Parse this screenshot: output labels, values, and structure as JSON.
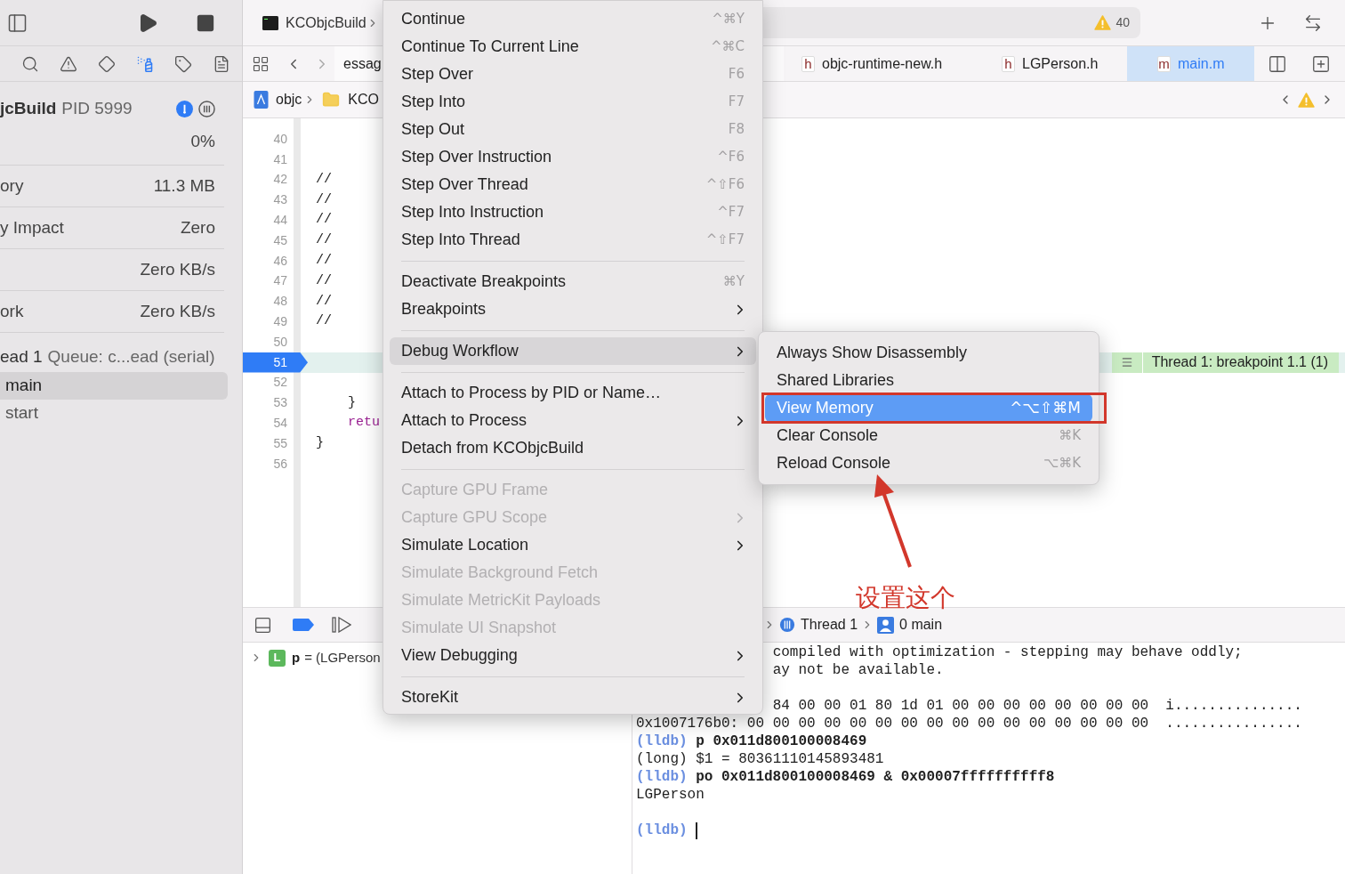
{
  "sidebar": {
    "process": {
      "name": "jcBuild",
      "pid": "PID 5999"
    },
    "gauges": [
      {
        "value": "0%"
      },
      {
        "label": "ory",
        "value": "11.3 MB"
      },
      {
        "label": "y Impact",
        "value": "Zero"
      },
      {
        "value": "Zero KB/s"
      },
      {
        "label": "ork",
        "value": "Zero KB/s"
      }
    ],
    "thread": {
      "name": "ead 1",
      "detail": "Queue: c...ead (serial)"
    },
    "frames": [
      {
        "label": "main",
        "selected": true
      },
      {
        "label": "start",
        "selected": false
      }
    ]
  },
  "toolbar": {
    "scheme": "KCObjcBuild",
    "warning_count": "40"
  },
  "tabs": [
    {
      "label": "essag",
      "selected": false
    },
    {
      "file_type": "h",
      "label": "objc-runtime-new.h",
      "selected": false
    },
    {
      "file_type": "h",
      "label": "LGPerson.h",
      "selected": false
    },
    {
      "file_type": "m",
      "label": "main.m",
      "selected": true
    }
  ],
  "jump_bar": [
    {
      "kind": "project",
      "label": "objc"
    },
    {
      "kind": "folder",
      "label": "KCO"
    }
  ],
  "code_lines": [
    {
      "number": "40",
      "kind": "plain",
      "breakpoint": false
    },
    {
      "number": "41",
      "kind": "plain",
      "breakpoint": false
    },
    {
      "number": "42",
      "code": "//",
      "kind": "plain",
      "breakpoint": false
    },
    {
      "number": "43",
      "code": "//",
      "kind": "plain",
      "breakpoint": false
    },
    {
      "number": "44",
      "code": "//",
      "kind": "plain",
      "breakpoint": false
    },
    {
      "number": "45",
      "code": "//",
      "kind": "plain",
      "breakpoint": false
    },
    {
      "number": "46",
      "code": "//",
      "kind": "plain",
      "breakpoint": false
    },
    {
      "number": "47",
      "code": "//",
      "kind": "plain",
      "breakpoint": false
    },
    {
      "number": "48",
      "code": "//",
      "kind": "plain",
      "breakpoint": false
    },
    {
      "number": "49",
      "code": "//",
      "kind": "plain",
      "breakpoint": false
    },
    {
      "number": "50",
      "kind": "plain",
      "breakpoint": false
    },
    {
      "number": "51",
      "kind": "plain",
      "breakpoint": true,
      "annotation": "Thread 1: breakpoint 1.1 (1)"
    },
    {
      "number": "52",
      "kind": "plain",
      "breakpoint": false
    },
    {
      "number": "53",
      "code": "    }",
      "kind": "plain",
      "breakpoint": false
    },
    {
      "number": "54",
      "code": "    retu",
      "kind": "keyword",
      "breakpoint": false
    },
    {
      "number": "55",
      "code": "}",
      "kind": "plain",
      "breakpoint": false
    },
    {
      "number": "56",
      "kind": "plain",
      "breakpoint": false
    }
  ],
  "debug_bar": {
    "path": [
      {
        "kind": "thread",
        "label": "Thread 1"
      },
      {
        "kind": "frame",
        "label": "0 main"
      }
    ]
  },
  "variables": [
    {
      "scope": "L",
      "name": "p",
      "value": "= (LGPerson",
      "expanded": false
    }
  ],
  "console": [
    {
      "kind": "tail",
      "text": "compiled with optimization - stepping may behave oddly;"
    },
    {
      "kind": "tail",
      "text": "ay not be available."
    },
    {
      "kind": "blank"
    },
    {
      "kind": "tail",
      "text": "84 00 00 01 80 1d 01 00 00 00 00 00 00 00 00  i..............."
    },
    {
      "kind": "output",
      "text": "0x1007176b0: 00 00 00 00 00 00 00 00 00 00 00 00 00 00 00 00  ................"
    },
    {
      "kind": "command",
      "prompt": "(lldb)",
      "text": "p 0x011d800100008469"
    },
    {
      "kind": "output",
      "text": "(long) $1 = 80361110145893481"
    },
    {
      "kind": "command",
      "prompt": "(lldb)",
      "text": "po 0x011d800100008469 & 0x00007ffffffffff8"
    },
    {
      "kind": "output",
      "text": "LGPerson"
    },
    {
      "kind": "blank"
    },
    {
      "kind": "input",
      "prompt": "(lldb)"
    }
  ],
  "menu": [
    {
      "kind": "item",
      "label": "Continue",
      "shortcut": "^⌘Y",
      "submenu": false,
      "disabled": false,
      "selected": false
    },
    {
      "kind": "item",
      "label": "Continue To Current Line",
      "shortcut": "^⌘C",
      "submenu": false,
      "disabled": false,
      "selected": false
    },
    {
      "kind": "item",
      "label": "Step Over",
      "shortcut": "F6",
      "submenu": false,
      "disabled": false,
      "selected": false
    },
    {
      "kind": "item",
      "label": "Step Into",
      "shortcut": "F7",
      "submenu": false,
      "disabled": false,
      "selected": false
    },
    {
      "kind": "item",
      "label": "Step Out",
      "shortcut": "F8",
      "submenu": false,
      "disabled": false,
      "selected": false
    },
    {
      "kind": "item",
      "label": "Step Over Instruction",
      "shortcut": "^F6",
      "submenu": false,
      "disabled": false,
      "selected": false
    },
    {
      "kind": "item",
      "label": "Step Over Thread",
      "shortcut": "^⇧F6",
      "submenu": false,
      "disabled": false,
      "selected": false
    },
    {
      "kind": "item",
      "label": "Step Into Instruction",
      "shortcut": "^F7",
      "submenu": false,
      "disabled": false,
      "selected": false
    },
    {
      "kind": "item",
      "label": "Step Into Thread",
      "shortcut": "^⇧F7",
      "submenu": false,
      "disabled": false,
      "selected": false
    },
    {
      "kind": "separator"
    },
    {
      "kind": "item",
      "label": "Deactivate Breakpoints",
      "shortcut": "⌘Y",
      "submenu": false,
      "disabled": false,
      "selected": false
    },
    {
      "kind": "item",
      "label": "Breakpoints",
      "submenu": true,
      "disabled": false,
      "selected": false
    },
    {
      "kind": "separator"
    },
    {
      "kind": "item",
      "label": "Debug Workflow",
      "submenu": true,
      "disabled": false,
      "selected": true
    },
    {
      "kind": "separator"
    },
    {
      "kind": "item",
      "label": "Attach to Process by PID or Name…",
      "submenu": false,
      "disabled": false,
      "selected": false
    },
    {
      "kind": "item",
      "label": "Attach to Process",
      "submenu": true,
      "disabled": false,
      "selected": false
    },
    {
      "kind": "item",
      "label": "Detach from KCObjcBuild",
      "submenu": false,
      "disabled": false,
      "selected": false
    },
    {
      "kind": "separator"
    },
    {
      "kind": "item",
      "label": "Capture GPU Frame",
      "submenu": false,
      "disabled": true,
      "selected": false
    },
    {
      "kind": "item",
      "label": "Capture GPU Scope",
      "submenu": true,
      "disabled": true,
      "selected": false
    },
    {
      "kind": "item",
      "label": "Simulate Location",
      "submenu": true,
      "disabled": false,
      "selected": false
    },
    {
      "kind": "item",
      "label": "Simulate Background Fetch",
      "submenu": false,
      "disabled": true,
      "selected": false
    },
    {
      "kind": "item",
      "label": "Simulate MetricKit Payloads",
      "submenu": false,
      "disabled": true,
      "selected": false
    },
    {
      "kind": "item",
      "label": "Simulate UI Snapshot",
      "submenu": false,
      "disabled": true,
      "selected": false
    },
    {
      "kind": "item",
      "label": "View Debugging",
      "submenu": true,
      "disabled": false,
      "selected": false
    },
    {
      "kind": "separator"
    },
    {
      "kind": "item",
      "label": "StoreKit",
      "submenu": true,
      "disabled": false,
      "selected": false
    }
  ],
  "submenu": [
    {
      "kind": "item",
      "label": "Always Show Disassembly",
      "submenu": false,
      "disabled": false,
      "selected": false
    },
    {
      "kind": "item",
      "label": "Shared Libraries",
      "submenu": false,
      "disabled": false,
      "selected": false
    },
    {
      "kind": "item",
      "label": "View Memory",
      "shortcut": "^⌥⇧⌘M",
      "submenu": false,
      "disabled": false,
      "selected": true
    },
    {
      "kind": "item",
      "label": "Clear Console",
      "shortcut": "⌘K",
      "submenu": false,
      "disabled": false,
      "selected": false
    },
    {
      "kind": "item",
      "label": "Reload Console",
      "shortcut": "⌥⌘K",
      "submenu": false,
      "disabled": false,
      "selected": false
    }
  ],
  "annotation": {
    "text": "设置这个"
  }
}
